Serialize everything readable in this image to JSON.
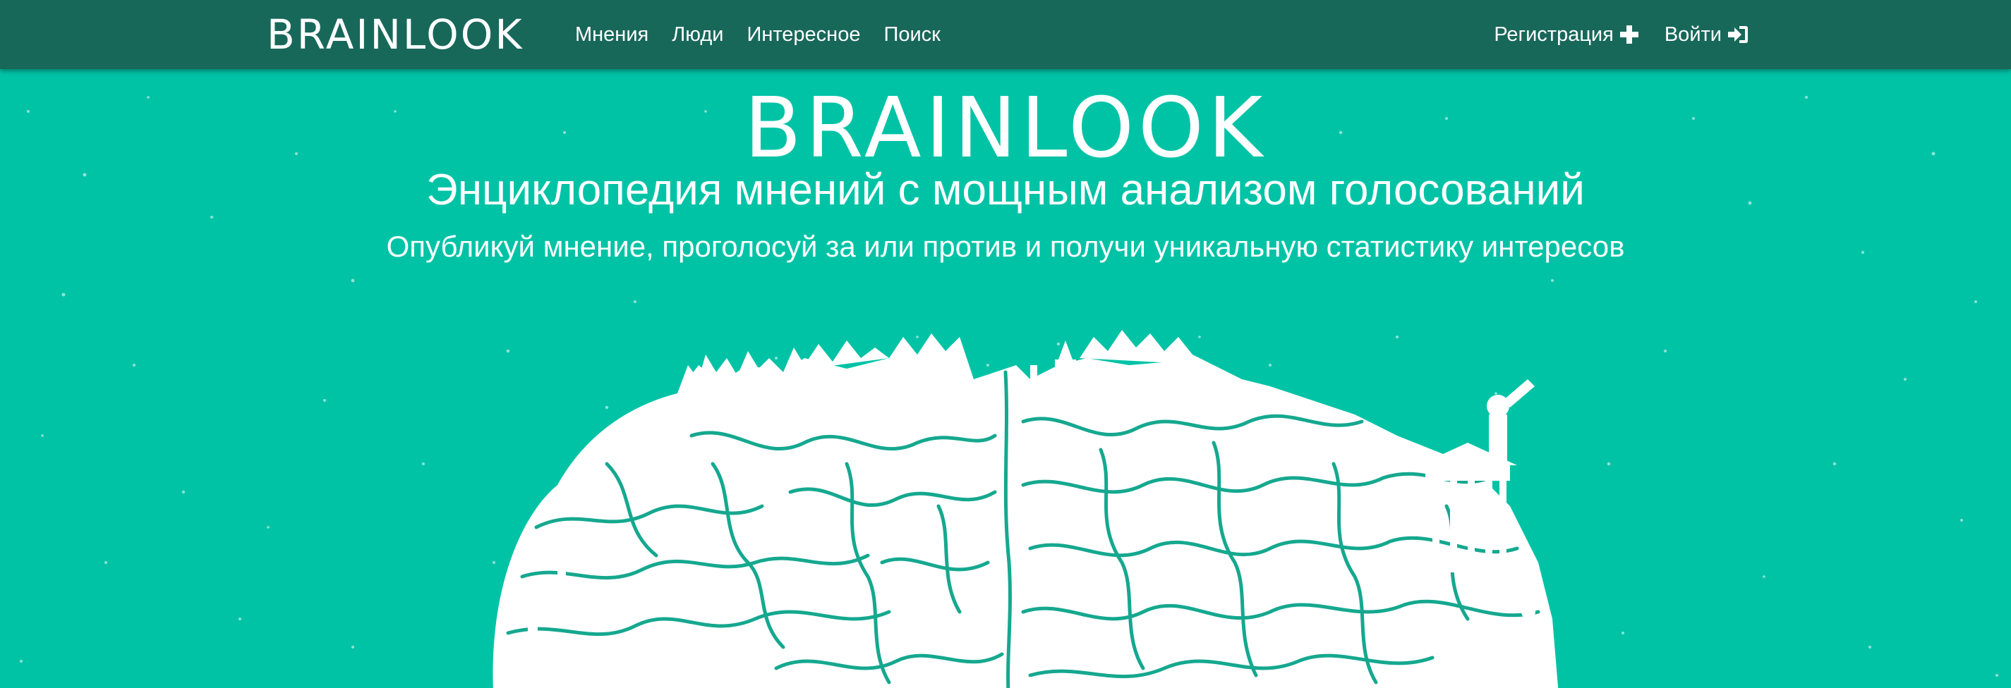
{
  "nav": {
    "logo": "BRAINLOOK",
    "links": [
      {
        "label": "Мнения"
      },
      {
        "label": "Люди"
      },
      {
        "label": "Интересное"
      },
      {
        "label": "Поиск"
      }
    ],
    "register_label": "Регистрация",
    "login_label": "Войти",
    "register_icon": "plus-icon",
    "login_icon": "sign-in-icon"
  },
  "hero": {
    "logo": "BRAINLOOK",
    "title": "Энциклопедия мнений с мощным анализом голосований",
    "subtitle": "Опубликуй мнение, проголосуй за или против и получи уникальную статистику интересов",
    "illustration": "brain-city-illustration"
  },
  "colors": {
    "navbar": "#18685a",
    "hero_background": "#00c3a6",
    "text": "#ffffff"
  }
}
